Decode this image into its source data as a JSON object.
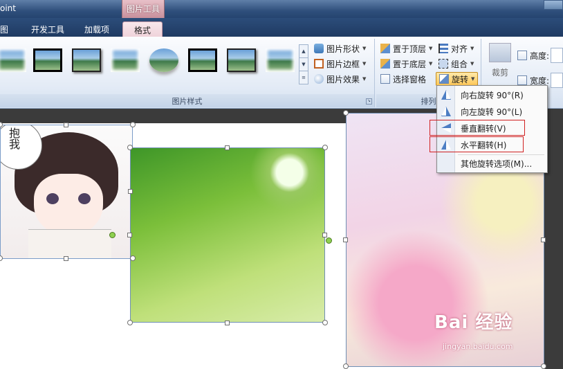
{
  "titlebar": {
    "app_title_fragment": "oint",
    "contextual_tab": "图片工具"
  },
  "tabs": [
    {
      "label": "图"
    },
    {
      "label": "开发工具"
    },
    {
      "label": "加载项"
    },
    {
      "label": "格式",
      "active": true
    }
  ],
  "ribbon": {
    "picture_styles": {
      "group_label": "图片样式",
      "shape": "图片形状",
      "border": "图片边框",
      "effect": "图片效果"
    },
    "arrange": {
      "group_label": "排列",
      "bring_front": "置于顶层",
      "send_back": "置于底层",
      "selection_pane": "选择窗格",
      "align": "对齐",
      "group": "组合",
      "rotate": "旋转"
    },
    "size": {
      "crop": "裁剪",
      "height": "高度:",
      "width": "宽度:"
    }
  },
  "rotate_menu": {
    "items": [
      {
        "label": "向右旋转 90°(R)",
        "icon": "rotate-right-icon"
      },
      {
        "label": "向左旋转 90°(L)",
        "icon": "rotate-left-icon"
      },
      {
        "label": "垂直翻转(V)",
        "icon": "flip-vertical-icon",
        "highlighted": true
      },
      {
        "label": "水平翻转(H)",
        "icon": "flip-horizontal-icon",
        "highlighted": true
      },
      {
        "label": "其他旋转选项(M)..."
      }
    ]
  },
  "slide": {
    "bubble_text": "抱我",
    "watermark": "Bai 经验",
    "watermark_url": "jingyan.baidu.com"
  },
  "colors": {
    "highlight": "#d02020",
    "accent_tab": "#efd3da"
  }
}
